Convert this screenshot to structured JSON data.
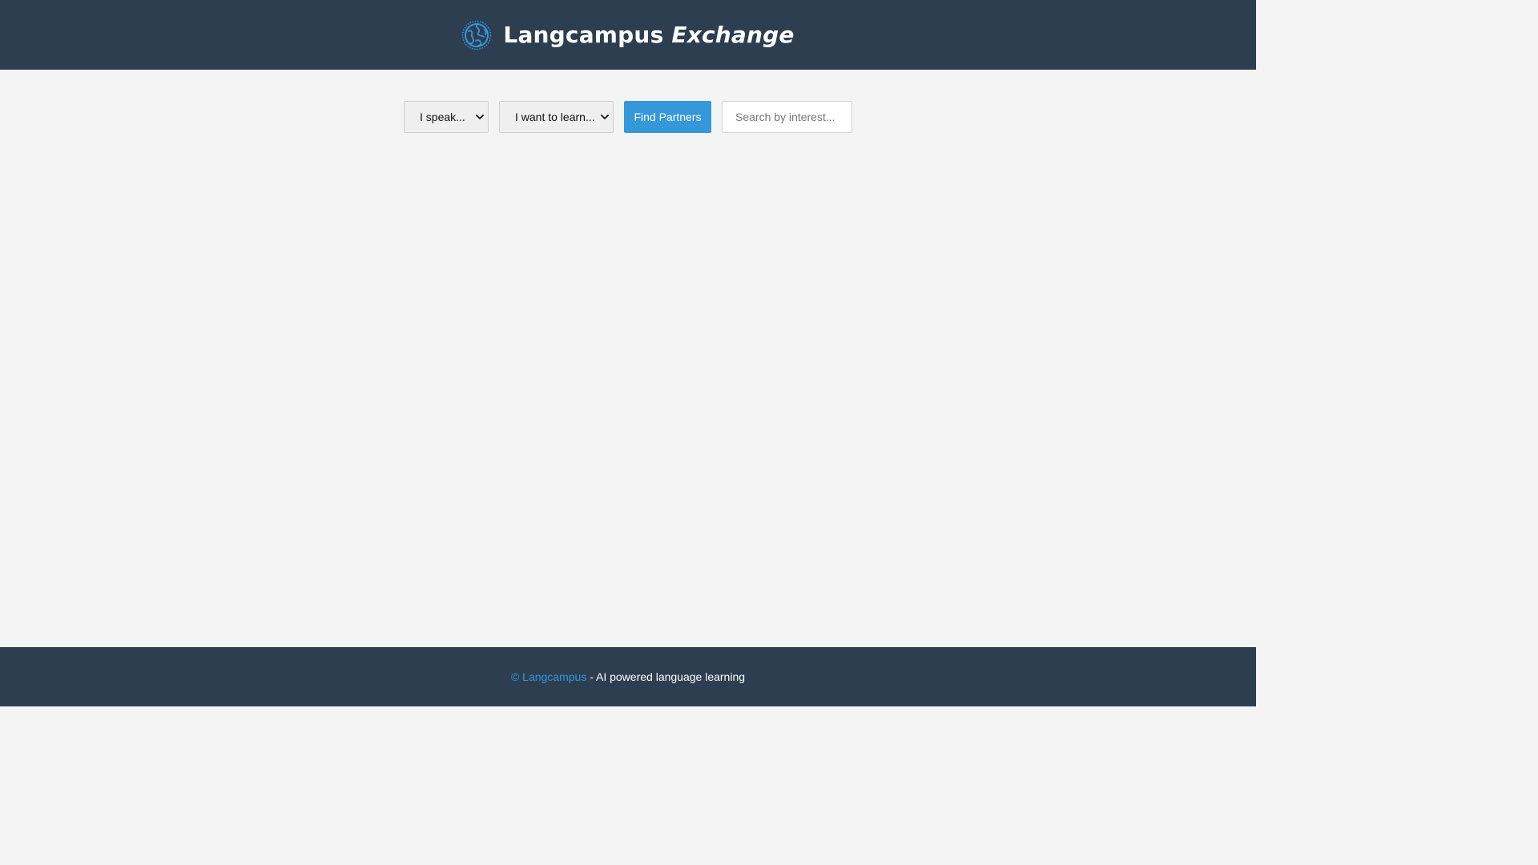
{
  "header": {
    "brand_main": "Langcampus",
    "brand_em": "Exchange",
    "logo_icon": "globe-icon"
  },
  "controls": {
    "speak_select": {
      "selected": "I speak...",
      "options": [
        "I speak..."
      ]
    },
    "learn_select": {
      "selected": "I want to learn...",
      "options": [
        "I want to learn..."
      ]
    },
    "find_button": "Find Partners",
    "search_placeholder": "Search by interest..."
  },
  "footer": {
    "link_text": "© Langcampus",
    "tagline": " - AI powered language learning"
  },
  "colors": {
    "header_bg": "#2c3e50",
    "accent": "#3498db",
    "page_bg": "#f4f4f4"
  }
}
